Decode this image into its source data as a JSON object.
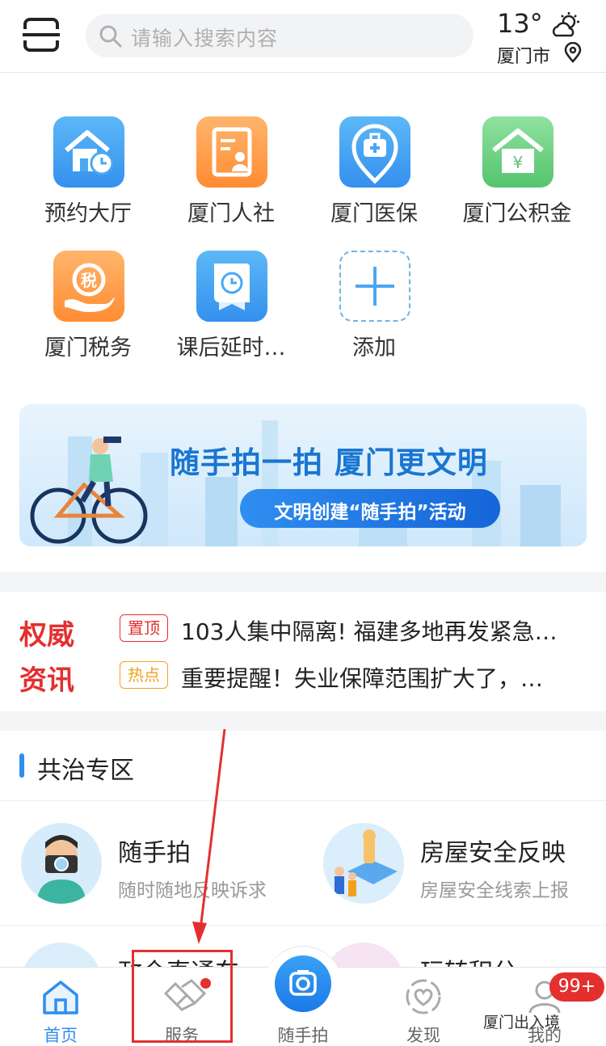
{
  "header": {
    "search_placeholder": "请输入搜索内容",
    "temperature": "13°",
    "city": "厦门市"
  },
  "services": [
    {
      "label": "预约大厅",
      "icon": "house-clock-icon",
      "color": "#3d9cf0"
    },
    {
      "label": "厦门人社",
      "icon": "id-card-icon",
      "color": "#ff9b45"
    },
    {
      "label": "厦门医保",
      "icon": "medical-kit-icon",
      "color": "#3d9cf0"
    },
    {
      "label": "厦门公积金",
      "icon": "house-yuan-icon",
      "color": "#62cc79"
    },
    {
      "label": "厦门税务",
      "icon": "tax-hand-icon",
      "color": "#ff9b45"
    },
    {
      "label": "课后延时…",
      "icon": "book-clock-icon",
      "color": "#3d9cf0"
    },
    {
      "label": "添加",
      "icon": "plus-icon",
      "color": "#6cb4e8"
    }
  ],
  "banner": {
    "title": "随手拍一拍 厦门更文明",
    "pill": "文明创建“随手拍”活动"
  },
  "news": {
    "brand_line1": "权威",
    "brand_line2": "资讯",
    "items": [
      {
        "badge": "置顶",
        "text": "103人集中隔离! 福建多地再发紧急…"
      },
      {
        "badge": "热点",
        "text": "重要提醒！失业保障范围扩大了，…"
      }
    ]
  },
  "section": {
    "title": "共治专区",
    "features": [
      {
        "title": "随手拍",
        "subtitle": "随时随地反映诉求"
      },
      {
        "title": "房屋安全反映",
        "subtitle": "房屋安全线索上报"
      },
      {
        "title": "政企直通车",
        "subtitle": ""
      },
      {
        "title": "玩转积分",
        "subtitle": ""
      }
    ]
  },
  "tabbar": {
    "items": [
      {
        "label": "首页",
        "active": true
      },
      {
        "label": "服务",
        "active": false
      },
      {
        "label": "随手拍",
        "active": false
      },
      {
        "label": "发现",
        "active": false
      },
      {
        "label": "我的",
        "active": false
      }
    ],
    "mine_badge": "99+"
  },
  "watermark": "厦门出入境",
  "colors": {
    "accent": "#2f8ef0",
    "red": "#e3302f",
    "hot": "#f0a21f"
  }
}
